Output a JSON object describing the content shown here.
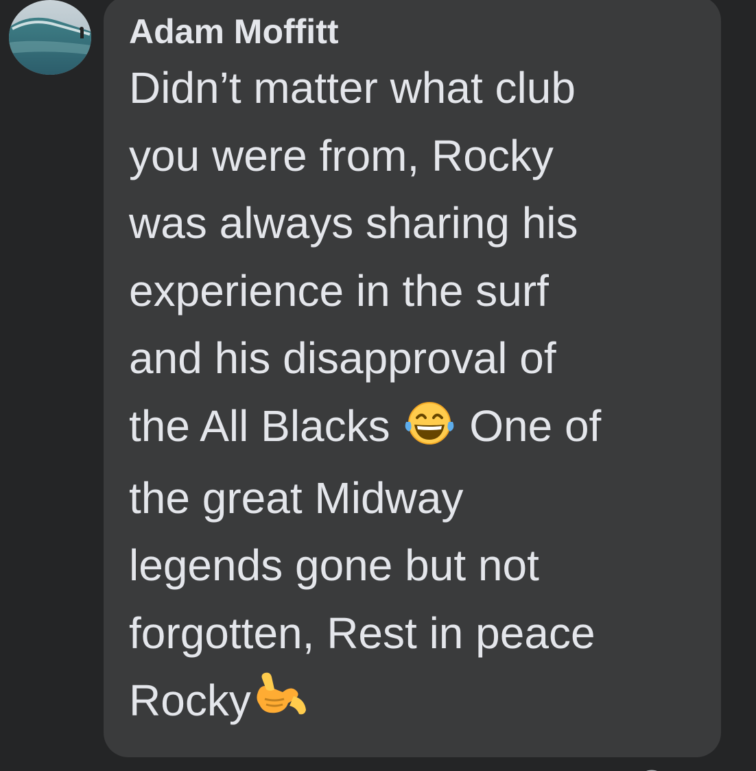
{
  "comment": {
    "author": "Adam Moffitt",
    "lines": [
      "Didn’t matter what club",
      "you were from, Rocky",
      "was always sharing his",
      "experience in the surf",
      "and his disapproval of"
    ],
    "line6_before": "the All Blacks ",
    "line6_after": " One of",
    "lines_tail": [
      "the great Midway",
      "legends gone but not",
      "forgotten, Rest in peace"
    ],
    "last_line": "Rocky",
    "emoji_laughing": "face-with-tears-of-joy-icon",
    "emoji_shaka": "call-me-hand-icon"
  },
  "colors": {
    "background": "#242526",
    "bubble": "#3a3b3c",
    "text": "#e4e6eb"
  }
}
